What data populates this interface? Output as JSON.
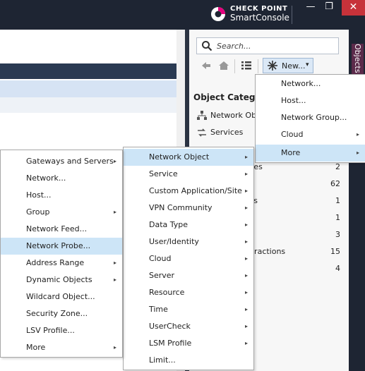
{
  "brand": {
    "line1": "CHECK POINT",
    "line2": "SmartConsole"
  },
  "window_controls": {
    "minimize": "—",
    "maximize": "❐",
    "close": "✕"
  },
  "side_tab": {
    "label": "Objects"
  },
  "search": {
    "placeholder": "Search..."
  },
  "toolbar": {
    "new_label": "New...",
    "new_caret": "▾"
  },
  "categories": {
    "title": "Object Categories",
    "items": [
      {
        "label": "Network Obj"
      },
      {
        "label": "Services"
      },
      {
        "label": "s"
      },
      {
        "label": "nities",
        "count": "2"
      },
      {
        "label": "",
        "count": "62"
      },
      {
        "label": "ities",
        "count": "1"
      },
      {
        "label": "",
        "count": "1"
      },
      {
        "label": "s",
        "count": "3"
      },
      {
        "label": "nteractions",
        "count": "15"
      },
      {
        "label": "",
        "count": "4"
      }
    ]
  },
  "menu_new": {
    "items": [
      {
        "label": "Network...",
        "submenu": false
      },
      {
        "label": "Host...",
        "submenu": false
      },
      {
        "label": "Network Group...",
        "submenu": false
      },
      {
        "label": "Cloud",
        "submenu": true
      },
      {
        "label": "More",
        "submenu": true
      }
    ]
  },
  "menu_more": {
    "items": [
      {
        "label": "Network Object",
        "submenu": true
      },
      {
        "label": "Service",
        "submenu": true
      },
      {
        "label": "Custom Application/Site",
        "submenu": true
      },
      {
        "label": "VPN Community",
        "submenu": true
      },
      {
        "label": "Data Type",
        "submenu": true
      },
      {
        "label": "User/Identity",
        "submenu": true
      },
      {
        "label": "Cloud",
        "submenu": true
      },
      {
        "label": "Server",
        "submenu": true
      },
      {
        "label": "Resource",
        "submenu": true
      },
      {
        "label": "Time",
        "submenu": true
      },
      {
        "label": "UserCheck",
        "submenu": true
      },
      {
        "label": "LSM Profile",
        "submenu": true
      },
      {
        "label": "Limit...",
        "submenu": false
      }
    ]
  },
  "menu_network_object": {
    "items": [
      {
        "label": "Gateways and Servers",
        "submenu": true
      },
      {
        "label": "Network...",
        "submenu": false
      },
      {
        "label": "Host...",
        "submenu": false
      },
      {
        "label": "Group",
        "submenu": true
      },
      {
        "label": "Network Feed...",
        "submenu": false
      },
      {
        "label": "Network Probe...",
        "submenu": false
      },
      {
        "label": "Address Range",
        "submenu": true
      },
      {
        "label": "Dynamic Objects",
        "submenu": true
      },
      {
        "label": "Wildcard Object...",
        "submenu": false
      },
      {
        "label": "Security Zone...",
        "submenu": false
      },
      {
        "label": "LSV Profile...",
        "submenu": false
      },
      {
        "label": "More",
        "submenu": true
      }
    ]
  },
  "arrow_glyph": "▸",
  "colors": {
    "titlebar": "#1e2533",
    "highlight": "#cde5f7",
    "close": "#c7323a"
  }
}
